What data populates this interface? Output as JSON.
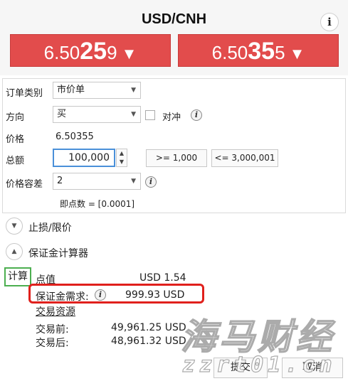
{
  "header": {
    "title": "USD/CNH",
    "info_label": "i"
  },
  "prices": {
    "bid": {
      "prefix": "6.50",
      "big": "25",
      "suffix": "9",
      "arrow": "▼"
    },
    "ask": {
      "prefix": "6.50",
      "big": "35",
      "suffix": "5",
      "arrow": "▼"
    }
  },
  "order": {
    "order_type_label": "订单类别",
    "order_type_value": "市价单",
    "direction_label": "方向",
    "direction_value": "买",
    "hedge_label": "对冲",
    "price_label": "价格",
    "price_value": "6.50355",
    "amount_label": "总额",
    "amount_value": "100,000",
    "min_amount": ">= 1,000",
    "max_amount": "<= 3,000,001",
    "tolerance_label": "价格容差",
    "tolerance_value": "2",
    "pip_note": "即点数 = [0.0001]"
  },
  "sections": {
    "stop_loss_label": "止损/限价",
    "margin_calc_label": "保证金计算器"
  },
  "margin": {
    "calc_button": "计算",
    "pip_value_label": "点值",
    "pip_value": "USD 1.54",
    "margin_req_label": "保证金需求:",
    "margin_req_value": "999.93 USD",
    "trading_resources_label": "交易资源",
    "before_label": "交易前:",
    "before_value": "49,961.25 USD",
    "after_label": "交易后:",
    "after_value": "48,961.32 USD"
  },
  "footer": {
    "submit_label": "提交",
    "cancel_label": "取消"
  },
  "watermark": {
    "text_cn": "海马财经",
    "text_en": "zzrt01.cn"
  },
  "colors": {
    "price_red": "#e24c4c",
    "highlight_red": "#e0201c",
    "calc_green": "#4caf50",
    "focus_blue": "#4a90d9"
  }
}
